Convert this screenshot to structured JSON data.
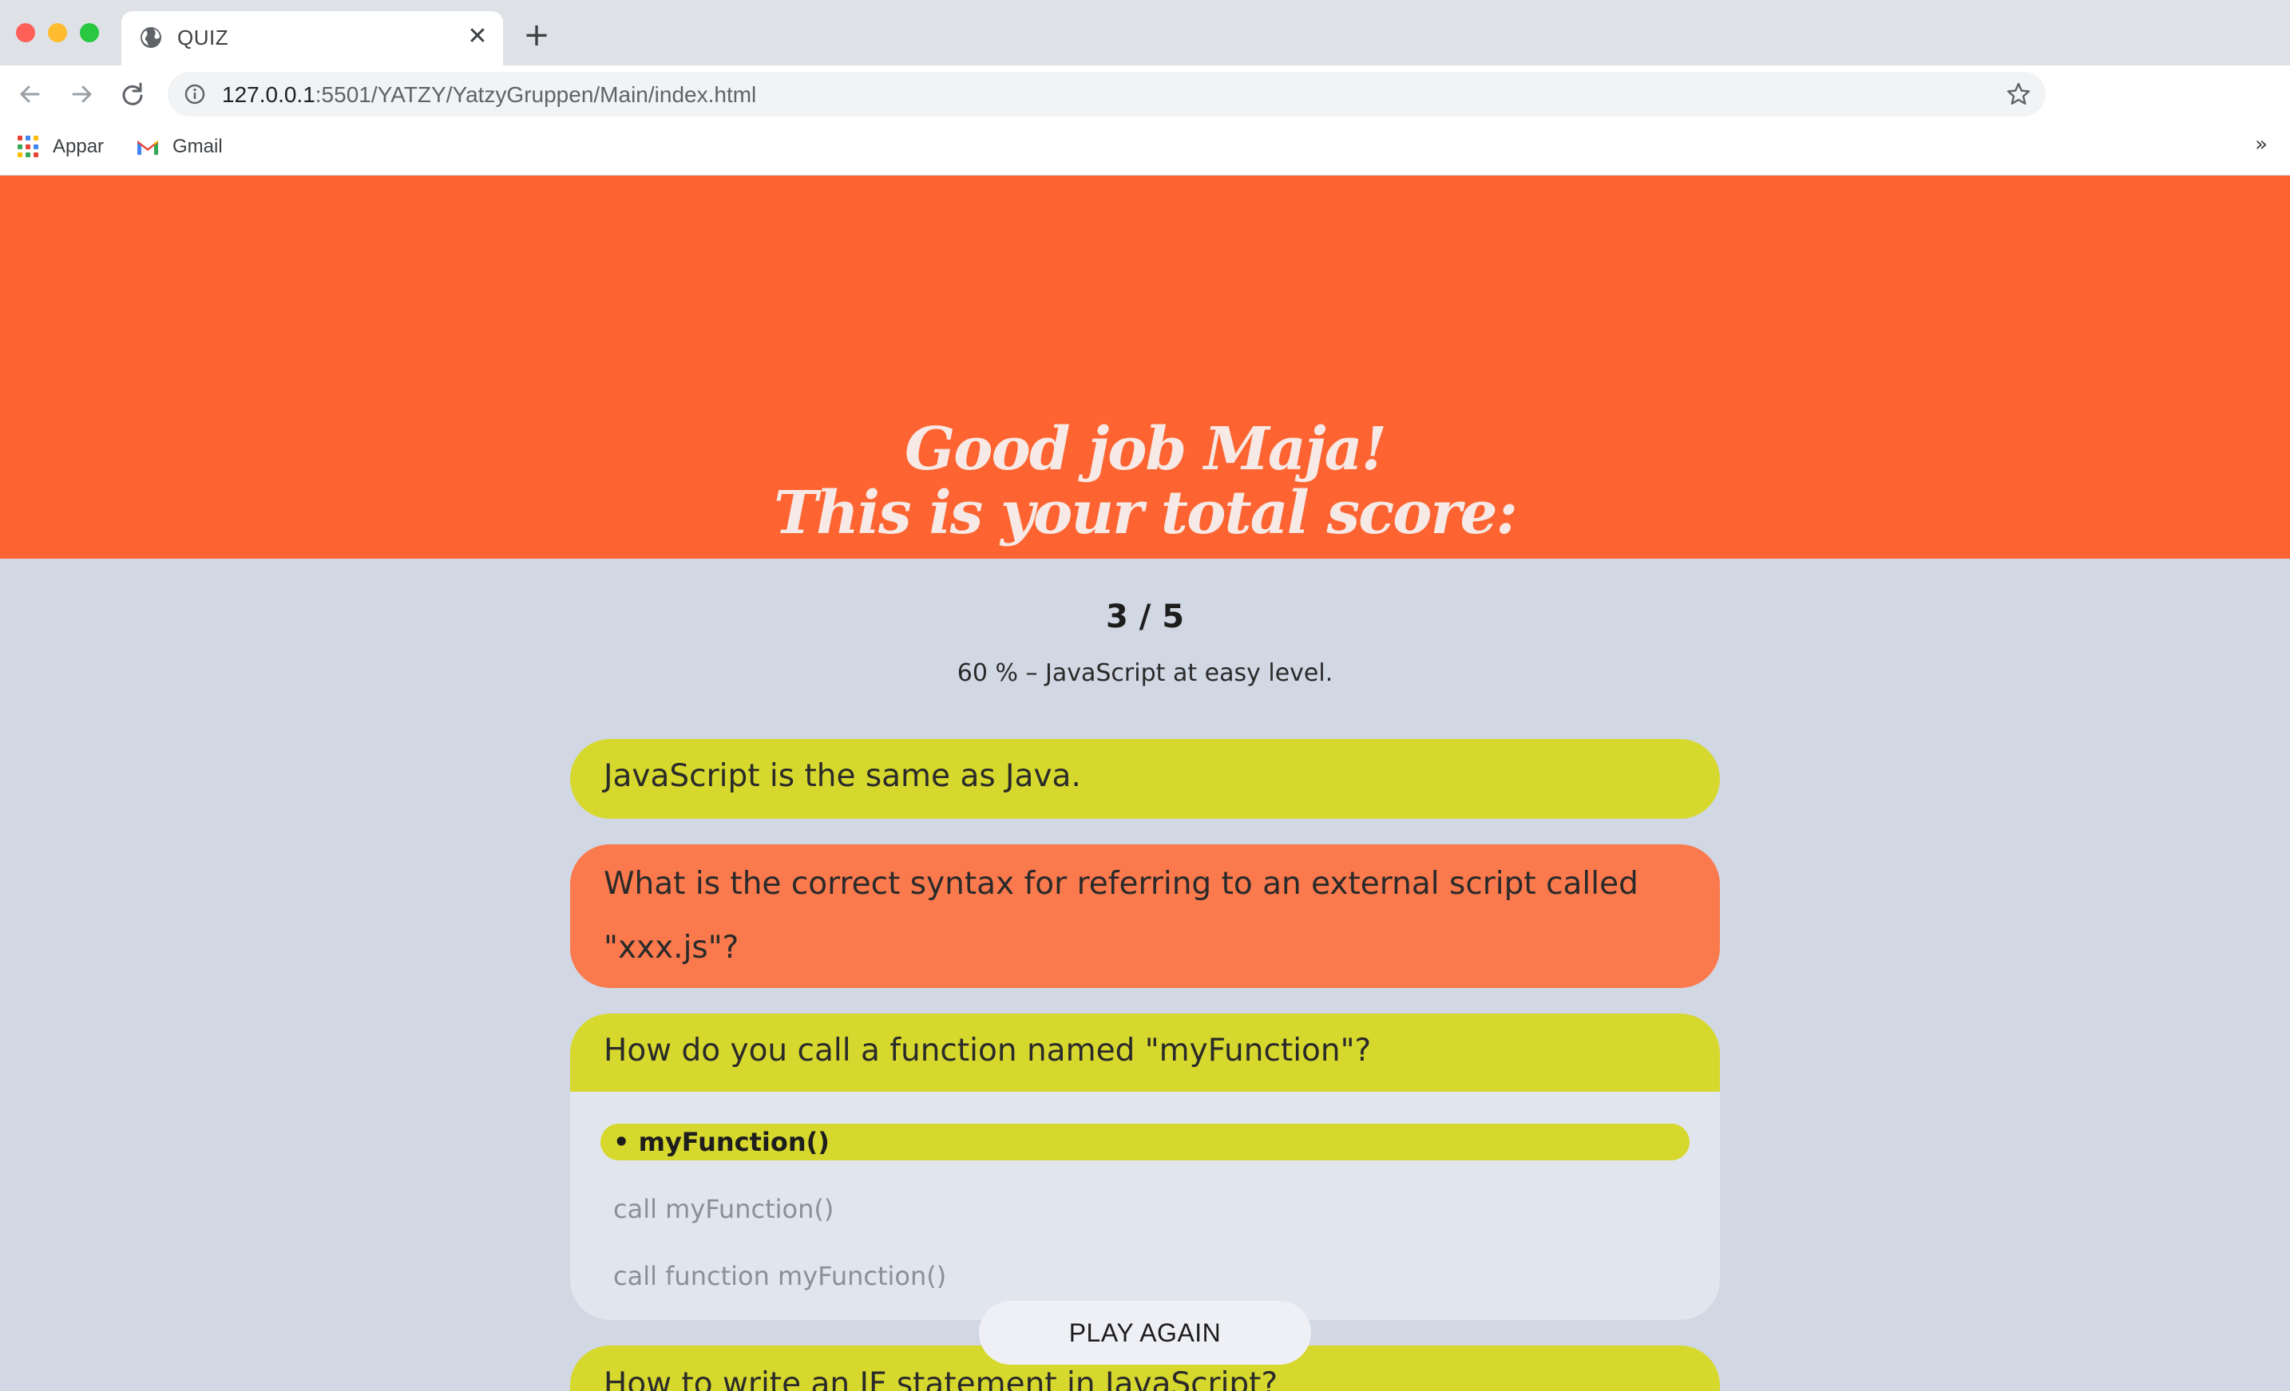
{
  "browser": {
    "tab_title": "QUIZ",
    "close_glyph": "✕",
    "newtab_glyph": "+",
    "url_host": "127.0.0.1",
    "url_rest": ":5501/YATZY/YatzyGruppen/Main/index.html",
    "bookmarks": [
      {
        "label": "Appar",
        "icon": "apps-grid-icon"
      },
      {
        "label": "Gmail",
        "icon": "gmail-icon"
      }
    ],
    "more_glyph": "»"
  },
  "hero": {
    "line1": "Good job Maja!",
    "line2": "This is your total score:"
  },
  "result": {
    "score": "3 / 5",
    "summary": "60 % – JavaScript at easy level."
  },
  "questions": [
    {
      "text": "JavaScript is the same as Java.",
      "status": "correct"
    },
    {
      "text": "What is the correct syntax for referring to an external script called \"xxx.js\"?",
      "status": "wrong"
    },
    {
      "text": "How do you call a function named \"myFunction\"?",
      "status": "correct",
      "options": [
        "• myFunction()",
        "call myFunction()",
        "call function myFunction()"
      ],
      "selected_index": 0
    },
    {
      "text": "How to write an IF statement in JavaScript?",
      "status": "correct"
    }
  ],
  "play_again_label": "PLAY AGAIN",
  "colors": {
    "hero": "#fd6431",
    "correct": "#d6d82e",
    "wrong": "#fb7a4d",
    "background": "#d1d7e3"
  }
}
